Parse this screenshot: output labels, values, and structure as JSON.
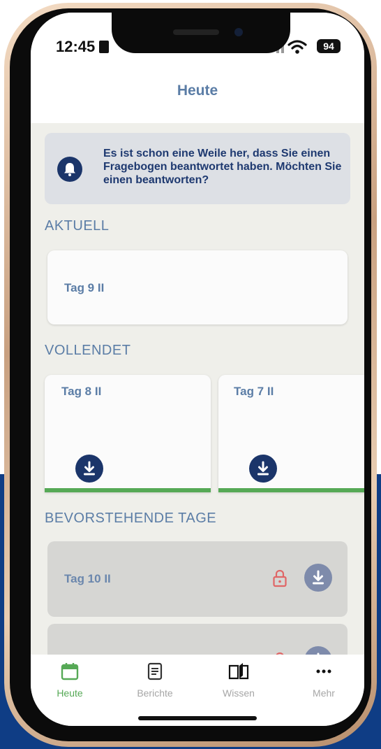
{
  "status_bar": {
    "time": "12:45",
    "battery": "94"
  },
  "header": {
    "title": "Heute"
  },
  "banner": {
    "text": "Es ist schon eine Weile her, dass Sie einen Fragebogen beantwortet haben. Möchten Sie einen beantworten?"
  },
  "sections": {
    "current": "AKTUELL",
    "completed": "VOLLENDET",
    "upcoming": "BEVORSTEHENDE TAGE"
  },
  "current_items": [
    {
      "title": "Tag 9 II"
    }
  ],
  "completed_items": [
    {
      "title": "Tag 8 II"
    },
    {
      "title": "Tag 7 II"
    }
  ],
  "upcoming_items": [
    {
      "title": "Tag 10 II"
    },
    {
      "title": ""
    }
  ],
  "tabs": [
    {
      "label": "Heute",
      "icon": "calendar-icon",
      "active": true
    },
    {
      "label": "Berichte",
      "icon": "document-icon",
      "active": false
    },
    {
      "label": "Wissen",
      "icon": "book-icon",
      "active": false
    },
    {
      "label": "Mehr",
      "icon": "more-icon",
      "active": false
    }
  ],
  "colors": {
    "accent_green": "#56a956",
    "primary_blue": "#1b356a",
    "label_blue": "#5b7da6",
    "lock_red": "#e06666"
  }
}
